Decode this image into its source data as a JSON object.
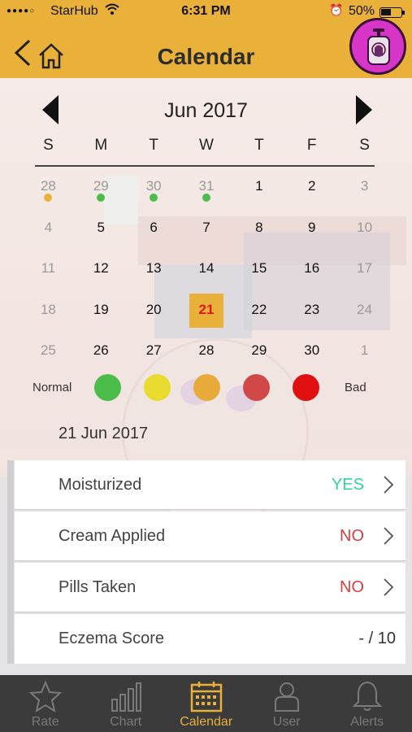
{
  "status_bar": {
    "carrier": "StarHub",
    "time": "6:31 PM",
    "battery": "50%"
  },
  "nav": {
    "title": "Calendar"
  },
  "calendar": {
    "month": "Jun 2017",
    "weekdays": [
      "S",
      "M",
      "T",
      "W",
      "T",
      "F",
      "S"
    ],
    "weeks": [
      [
        {
          "d": "28",
          "m": "out",
          "dot": "#eab13a"
        },
        {
          "d": "29",
          "m": "out",
          "dot": "#4cbc4a"
        },
        {
          "d": "30",
          "m": "out",
          "dot": "#4cbc4a"
        },
        {
          "d": "31",
          "m": "out",
          "dot": "#4cbc4a"
        },
        {
          "d": "1",
          "m": "in"
        },
        {
          "d": "2",
          "m": "in"
        },
        {
          "d": "3",
          "m": "out"
        }
      ],
      [
        {
          "d": "4",
          "m": "out"
        },
        {
          "d": "5",
          "m": "in"
        },
        {
          "d": "6",
          "m": "in"
        },
        {
          "d": "7",
          "m": "in"
        },
        {
          "d": "8",
          "m": "in"
        },
        {
          "d": "9",
          "m": "in"
        },
        {
          "d": "10",
          "m": "out"
        }
      ],
      [
        {
          "d": "11",
          "m": "out"
        },
        {
          "d": "12",
          "m": "in"
        },
        {
          "d": "13",
          "m": "in"
        },
        {
          "d": "14",
          "m": "in"
        },
        {
          "d": "15",
          "m": "in"
        },
        {
          "d": "16",
          "m": "in"
        },
        {
          "d": "17",
          "m": "out"
        }
      ],
      [
        {
          "d": "18",
          "m": "out"
        },
        {
          "d": "19",
          "m": "in"
        },
        {
          "d": "20",
          "m": "in"
        },
        {
          "d": "21",
          "m": "today"
        },
        {
          "d": "22",
          "m": "in"
        },
        {
          "d": "23",
          "m": "in"
        },
        {
          "d": "24",
          "m": "out"
        }
      ],
      [
        {
          "d": "25",
          "m": "out"
        },
        {
          "d": "26",
          "m": "in"
        },
        {
          "d": "27",
          "m": "in"
        },
        {
          "d": "28",
          "m": "in"
        },
        {
          "d": "29",
          "m": "in"
        },
        {
          "d": "30",
          "m": "in"
        },
        {
          "d": "1",
          "m": "out"
        }
      ]
    ]
  },
  "legend": {
    "left_label": "Normal",
    "right_label": "Bad",
    "colors": [
      "#4cbc4a",
      "#e9da2f",
      "#e8ab3a",
      "#d04848",
      "#e01010"
    ]
  },
  "selected_date": "21 Jun 2017",
  "details": [
    {
      "label": "Moisturized",
      "value": "YES",
      "color": "#34d39a",
      "chevron": true
    },
    {
      "label": "Cream Applied",
      "value": "NO",
      "color": "#d64040",
      "chevron": true
    },
    {
      "label": "Pills Taken",
      "value": "NO",
      "color": "#d64040",
      "chevron": true
    },
    {
      "label": "Eczema Score",
      "value": "- / 10",
      "color": "#333333",
      "chevron": false
    }
  ],
  "tabs": [
    {
      "label": "Rate",
      "icon": "star-icon",
      "active": false
    },
    {
      "label": "Chart",
      "icon": "bar-chart-icon",
      "active": false
    },
    {
      "label": "Calendar",
      "icon": "calendar-icon",
      "active": true
    },
    {
      "label": "User",
      "icon": "user-icon",
      "active": false
    },
    {
      "label": "Alerts",
      "icon": "bell-icon",
      "active": false
    }
  ],
  "theme": {
    "accent": "#eab13a",
    "tabbar_bg": "#3b3b3b",
    "today_text": "#d8181a"
  }
}
